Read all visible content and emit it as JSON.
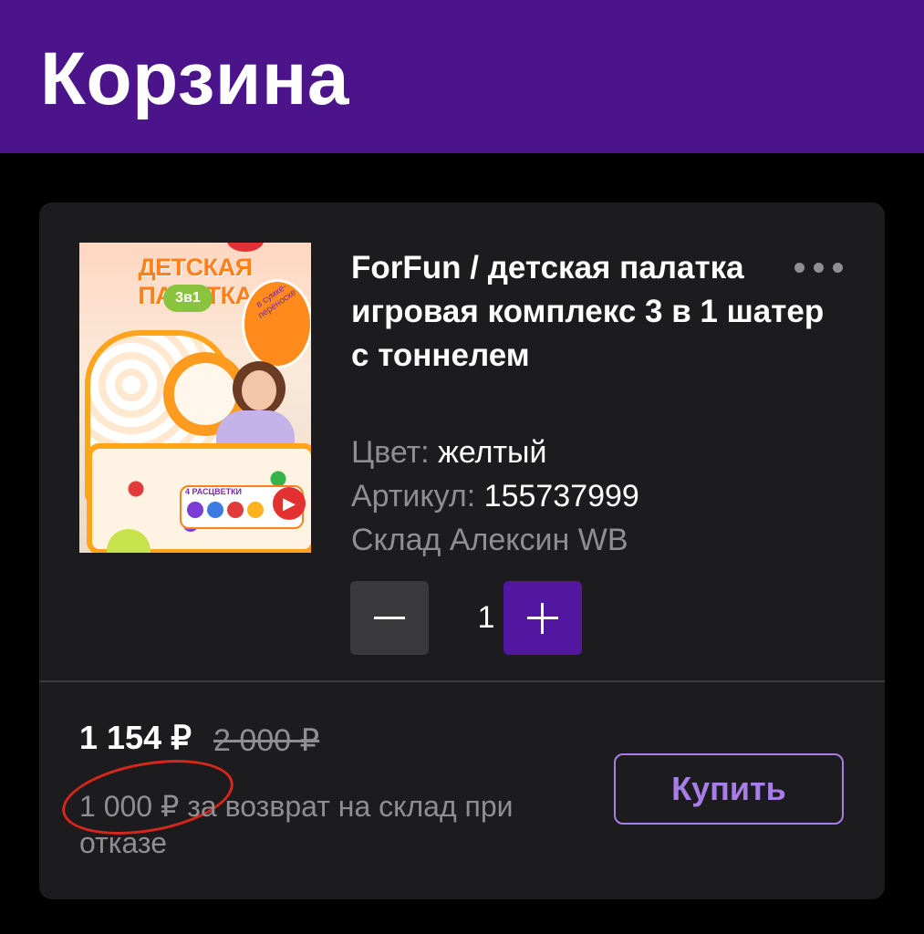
{
  "header": {
    "title": "Корзина",
    "background_color": "#4b148a"
  },
  "cart_item": {
    "image": {
      "headline": "ДЕТСКАЯ ПАЛАТКА",
      "badge": "3в1",
      "bag_label": "в сумке-переноске",
      "colors_label": "4 РАСЦВЕТКИ"
    },
    "title": "ForFun / детская палатка игровая комплекс 3 в 1 шатер с тоннелем",
    "more_icon": "more-horizontal-icon",
    "color_label": "Цвет:",
    "color_value": "желтый",
    "article_label": "Артикул:",
    "article_value": "155737999",
    "warehouse": "Склад Алексин WB",
    "quantity": "1",
    "price": "1 154 ₽",
    "old_price": "2 000 ₽",
    "return_note": "1 000 ₽ за возврат на склад при отказе",
    "buy_label": "Купить",
    "accent_color": "#5217a0",
    "buy_color": "#a97de8"
  }
}
